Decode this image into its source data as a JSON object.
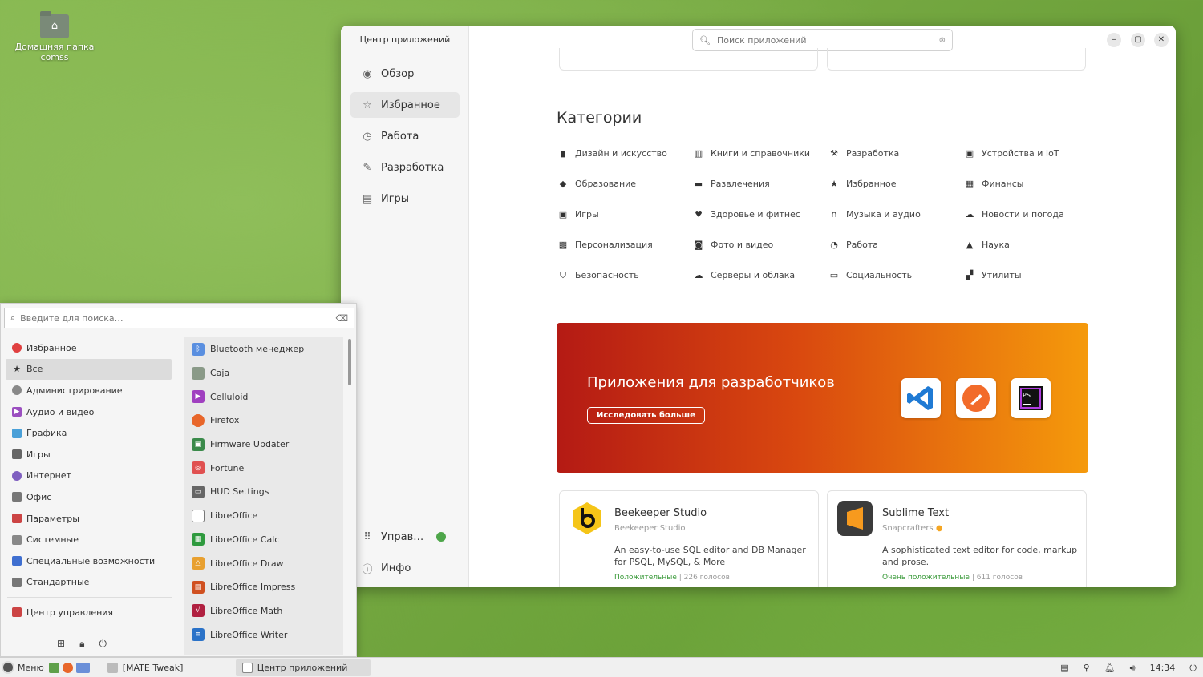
{
  "desktop": {
    "home_label_line1": "Домашняя папка",
    "home_label_line2": "comss"
  },
  "app_center": {
    "title": "Центр приложений",
    "search_placeholder": "Поиск приложений",
    "nav": [
      {
        "label": "Обзор",
        "icon": "compass-icon"
      },
      {
        "label": "Избранное",
        "icon": "star-icon"
      },
      {
        "label": "Работа",
        "icon": "clock-icon"
      },
      {
        "label": "Разработка",
        "icon": "wrench-icon"
      },
      {
        "label": "Игры",
        "icon": "gamepad-icon"
      }
    ],
    "nav_bottom": [
      {
        "label": "Управ…",
        "icon": "grid-icon"
      },
      {
        "label": "Инфо",
        "icon": "info-icon"
      }
    ],
    "categories_title": "Категории",
    "categories": [
      "Дизайн и искусство",
      "Книги и справочники",
      "Разработка",
      "Устройства и IoT",
      "Образование",
      "Развлечения",
      "Избранное",
      "Финансы",
      "Игры",
      "Здоровье и фитнес",
      "Музыка и аудио",
      "Новости и погода",
      "Персонализация",
      "Фото и видео",
      "Работа",
      "Наука",
      "Безопасность",
      "Серверы и облака",
      "Социальность",
      "Утилиты"
    ],
    "banner": {
      "title": "Приложения для разработчиков",
      "button": "Исследовать больше"
    },
    "cards": [
      {
        "name": "Beekeeper Studio",
        "publisher": "Beekeeper Studio",
        "description": "An easy-to-use SQL editor and DB Manager for PSQL, MySQL, & More",
        "rating": "Положительные",
        "votes": "| 226 голосов"
      },
      {
        "name": "Sublime Text",
        "publisher": "Snapcrafters",
        "description": "A sophisticated text editor for code, markup and prose.",
        "rating": "Очень положительные",
        "votes": "| 611 голосов"
      }
    ]
  },
  "menu": {
    "search_placeholder": "Введите для поиска…",
    "categories": [
      {
        "label": "Избранное",
        "color": "#e04040"
      },
      {
        "label": "Все",
        "color": "#333333"
      },
      {
        "label": "Администрирование",
        "color": "#888888"
      },
      {
        "label": "Аудио и видео",
        "color": "#9b4fc0"
      },
      {
        "label": "Графика",
        "color": "#4aa0d8"
      },
      {
        "label": "Игры",
        "color": "#666666"
      },
      {
        "label": "Интернет",
        "color": "#7f5fc0"
      },
      {
        "label": "Офис",
        "color": "#777777"
      },
      {
        "label": "Параметры",
        "color": "#cc4444"
      },
      {
        "label": "Системные",
        "color": "#888888"
      },
      {
        "label": "Специальные возможности",
        "color": "#3f6fd0"
      },
      {
        "label": "Стандартные",
        "color": "#777777"
      }
    ],
    "control_center": "Центр управления",
    "apps": [
      {
        "label": "Bluetooth менеджер",
        "color": "#5a8fe0"
      },
      {
        "label": "Caja",
        "color": "#8a9a88"
      },
      {
        "label": "Celluloid",
        "color": "#a040c0"
      },
      {
        "label": "Firefox",
        "color": "#e8662a"
      },
      {
        "label": "Firmware Updater",
        "color": "#3a8a4a"
      },
      {
        "label": "Fortune",
        "color": "#e05050"
      },
      {
        "label": "HUD Settings",
        "color": "#666666"
      },
      {
        "label": "LibreOffice",
        "color": "#ffffff"
      },
      {
        "label": "LibreOffice Calc",
        "color": "#2e9a3e"
      },
      {
        "label": "LibreOffice Draw",
        "color": "#e8a030"
      },
      {
        "label": "LibreOffice Impress",
        "color": "#d05020"
      },
      {
        "label": "LibreOffice Math",
        "color": "#b02040"
      },
      {
        "label": "LibreOffice Writer",
        "color": "#2a72c8"
      }
    ]
  },
  "panel": {
    "menu_label": "Меню",
    "tasks": [
      "[MATE Tweak]",
      "Центр приложений"
    ],
    "clock": "14:34"
  }
}
